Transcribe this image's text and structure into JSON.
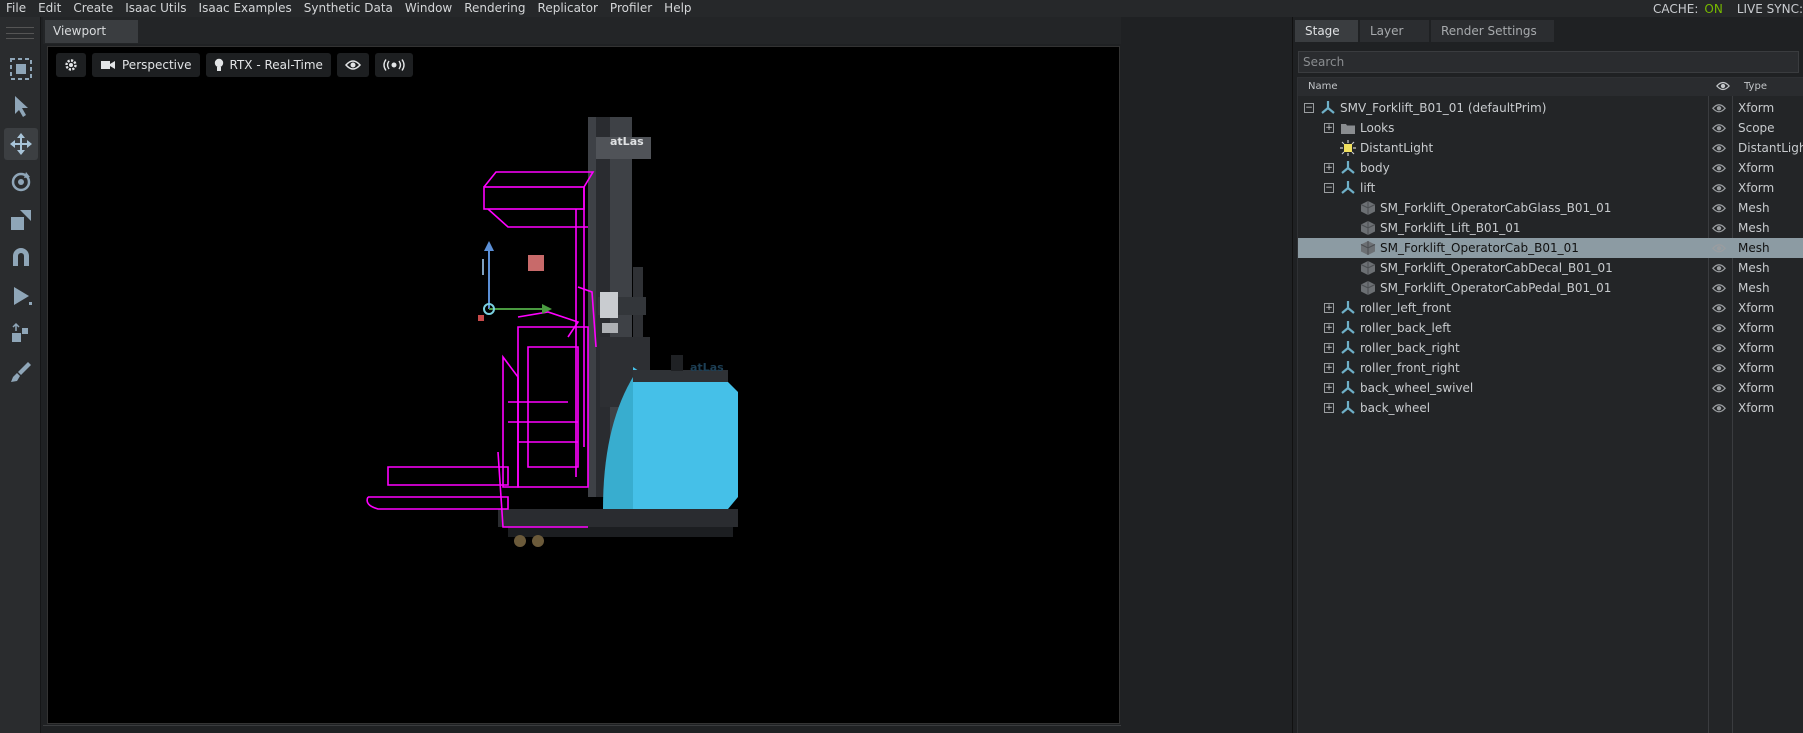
{
  "menu": [
    "File",
    "Edit",
    "Create",
    "Isaac Utils",
    "Isaac Examples",
    "Synthetic Data",
    "Window",
    "Rendering",
    "Replicator",
    "Profiler",
    "Help"
  ],
  "status": {
    "cache_label": "CACHE:",
    "cache_value": "ON",
    "live_sync_label": "LIVE SYNC:"
  },
  "viewport": {
    "tab": "Viewport",
    "camera_label": "Perspective",
    "renderer_label": "RTX - Real-Time",
    "model_logo_text": "atLas"
  },
  "toolbar_icons": [
    "select-frame-icon",
    "select-arrow-icon",
    "move-icon",
    "rotate-icon",
    "scale-icon",
    "snap-magnet-icon",
    "play-icon",
    "physics-icon",
    "paint-brush-icon"
  ],
  "panel": {
    "tabs": [
      "Stage",
      "Layer",
      "Render Settings"
    ],
    "search_placeholder": "Search",
    "col_name": "Name",
    "col_type": "Type"
  },
  "stage_tree": [
    {
      "name": "SMV_Forklift_B01_01 (defaultPrim)",
      "type": "Xform",
      "depth": 0,
      "expander": "minus",
      "icon": "xform-icon"
    },
    {
      "name": "Looks",
      "type": "Scope",
      "depth": 1,
      "expander": "plus",
      "icon": "folder-icon"
    },
    {
      "name": "DistantLight",
      "type": "DistantLight",
      "depth": 1,
      "expander": "",
      "icon": "light-icon"
    },
    {
      "name": "body",
      "type": "Xform",
      "depth": 1,
      "expander": "plus",
      "icon": "xform-icon"
    },
    {
      "name": "lift",
      "type": "Xform",
      "depth": 1,
      "expander": "minus",
      "icon": "xform-icon"
    },
    {
      "name": "SM_Forklift_OperatorCabGlass_B01_01",
      "type": "Mesh",
      "depth": 2,
      "expander": "",
      "icon": "mesh-icon"
    },
    {
      "name": "SM_Forklift_Lift_B01_01",
      "type": "Mesh",
      "depth": 2,
      "expander": "",
      "icon": "mesh-icon"
    },
    {
      "name": "SM_Forklift_OperatorCab_B01_01",
      "type": "Mesh",
      "depth": 2,
      "expander": "",
      "icon": "mesh-icon",
      "selected": true
    },
    {
      "name": "SM_Forklift_OperatorCabDecal_B01_01",
      "type": "Mesh",
      "depth": 2,
      "expander": "",
      "icon": "mesh-icon"
    },
    {
      "name": "SM_Forklift_OperatorCabPedal_B01_01",
      "type": "Mesh",
      "depth": 2,
      "expander": "",
      "icon": "mesh-icon"
    },
    {
      "name": "roller_left_front",
      "type": "Xform",
      "depth": 1,
      "expander": "plus",
      "icon": "xform-icon"
    },
    {
      "name": "roller_back_left",
      "type": "Xform",
      "depth": 1,
      "expander": "plus",
      "icon": "xform-icon"
    },
    {
      "name": "roller_back_right",
      "type": "Xform",
      "depth": 1,
      "expander": "plus",
      "icon": "xform-icon"
    },
    {
      "name": "roller_front_right",
      "type": "Xform",
      "depth": 1,
      "expander": "plus",
      "icon": "xform-icon"
    },
    {
      "name": "back_wheel_swivel",
      "type": "Xform",
      "depth": 1,
      "expander": "plus",
      "icon": "xform-icon"
    },
    {
      "name": "back_wheel",
      "type": "Xform",
      "depth": 1,
      "expander": "plus",
      "icon": "xform-icon"
    }
  ],
  "colors": {
    "accent_on": "#76b900",
    "selection": "#8c9ba3",
    "wireframe": "#ff00ff",
    "forklift_body": "#45c0e8"
  }
}
